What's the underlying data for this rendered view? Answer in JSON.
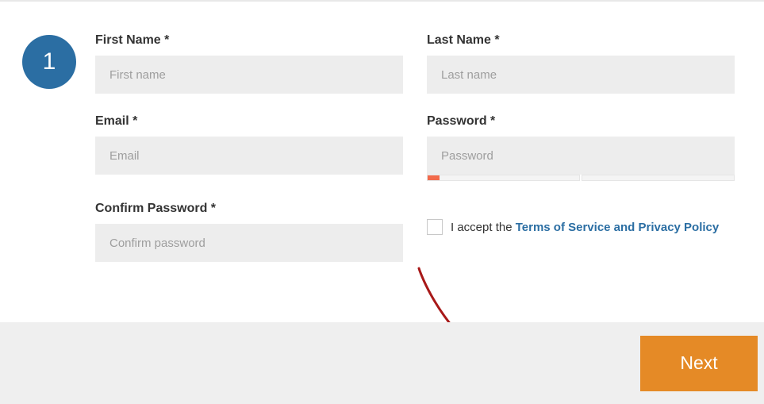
{
  "step": {
    "number": "1"
  },
  "fields": {
    "firstName": {
      "label": "First Name *",
      "placeholder": "First name",
      "value": ""
    },
    "lastName": {
      "label": "Last Name *",
      "placeholder": "Last name",
      "value": ""
    },
    "email": {
      "label": "Email *",
      "placeholder": "Email",
      "value": ""
    },
    "password": {
      "label": "Password *",
      "placeholder": "Password",
      "value": ""
    },
    "confirmPassword": {
      "label": "Confirm Password *",
      "placeholder": "Confirm password",
      "value": ""
    }
  },
  "terms": {
    "prefix": "I accept the ",
    "link": "Terms of Service and Privacy Policy"
  },
  "buttons": {
    "next": "Next"
  }
}
